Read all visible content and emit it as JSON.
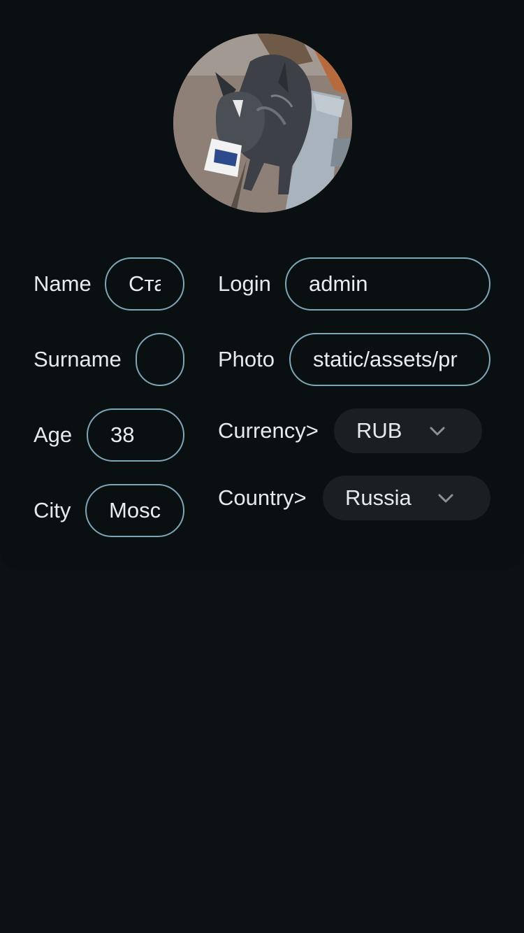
{
  "profile": {
    "avatar_alt": "dog-with-cup-photo"
  },
  "form": {
    "name_label": "Name",
    "name_value": "Cта",
    "surname_label": "Surname",
    "surname_value": "",
    "age_label": "Age",
    "age_value": "38",
    "city_label": "City",
    "city_value": "Mosc",
    "login_label": "Login",
    "login_value": "admin",
    "photo_label": "Photo",
    "photo_value": "static/assets/pr",
    "currency_label": "Currency>",
    "currency_value": "RUB",
    "country_label": "Country>",
    "country_value": "Russia"
  },
  "icons": {
    "dropdown": "chevron-down-icon"
  },
  "colors": {
    "background": "#0c1114",
    "field_border": "#7fa6b8",
    "select_bg": "#191f23",
    "text": "#e9edf0"
  }
}
